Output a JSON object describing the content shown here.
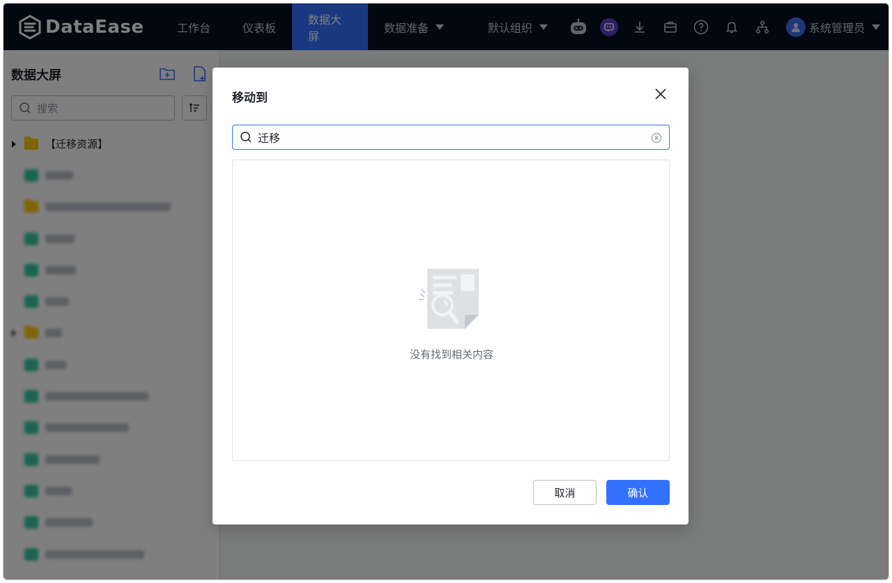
{
  "app": {
    "name": "DataEase"
  },
  "nav": {
    "items": [
      {
        "label": "工作台"
      },
      {
        "label": "仪表板"
      },
      {
        "label": "数据大屏"
      },
      {
        "label": "数据准备"
      }
    ],
    "active_index": 2
  },
  "header": {
    "org_label": "默认组织",
    "user_name": "系统管理员",
    "icons": [
      "robot-icon",
      "chat-icon",
      "download-icon",
      "briefcase-icon",
      "help-icon",
      "bell-icon",
      "org-tree-icon"
    ]
  },
  "sidebar": {
    "title": "数据大屏",
    "search_placeholder": "搜索",
    "items": [
      {
        "label": "【迁移资源】",
        "type": "folder",
        "expandable": true
      }
    ]
  },
  "dialog": {
    "title": "移动到",
    "search_value": "迁移",
    "empty_text": "没有找到相关内容",
    "cancel_label": "取消",
    "confirm_label": "确认"
  },
  "colors": {
    "topbar": "#050e21",
    "accent": "#3370ff",
    "folder": "#ffc60a",
    "screen_item": "#34c9a1"
  }
}
